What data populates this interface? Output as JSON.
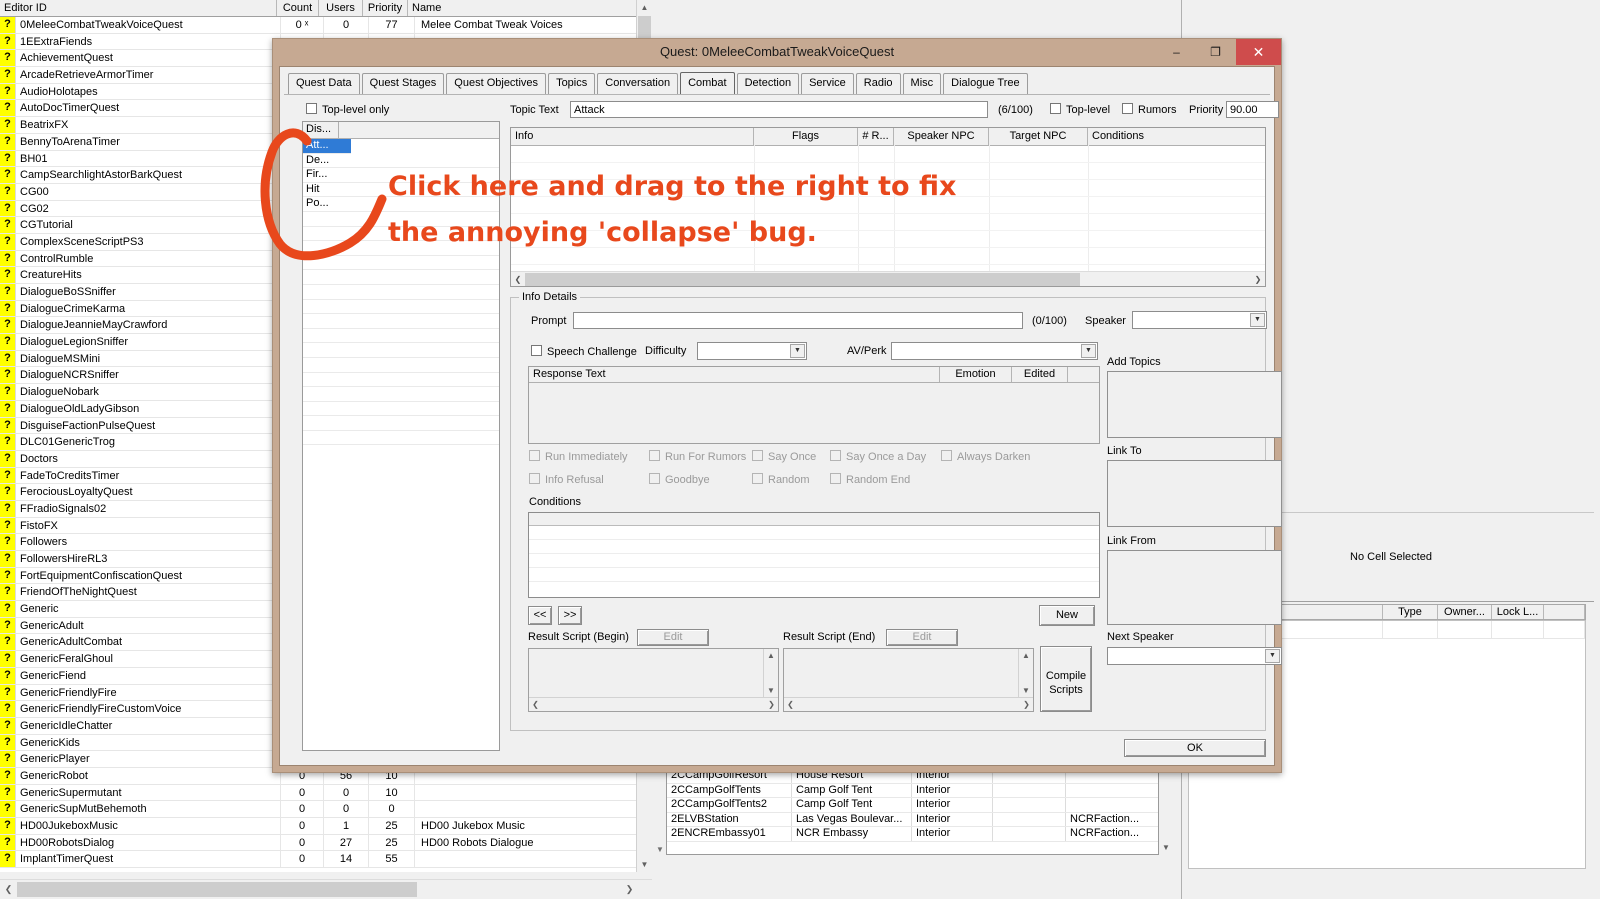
{
  "object_window": {
    "columns": [
      "Editor ID",
      "Count",
      "Users",
      "Priority",
      "Name"
    ],
    "rows": [
      {
        "id": "0MeleeCombatTweakVoiceQuest",
        "count": "0 ˣ",
        "users": "0",
        "priority": "77",
        "name": "Melee Combat Tweak Voices"
      },
      {
        "id": "1EExtraFiends",
        "count": "",
        "users": "",
        "priority": "",
        "name": ""
      },
      {
        "id": "AchievementQuest",
        "count": "",
        "users": "",
        "priority": "",
        "name": ""
      },
      {
        "id": "ArcadeRetrieveArmorTimer",
        "count": "",
        "users": "",
        "priority": "",
        "name": ""
      },
      {
        "id": "AudioHolotapes",
        "count": "",
        "users": "",
        "priority": "",
        "name": ""
      },
      {
        "id": "AutoDocTimerQuest",
        "count": "",
        "users": "",
        "priority": "",
        "name": ""
      },
      {
        "id": "BeatrixFX",
        "count": "",
        "users": "",
        "priority": "",
        "name": ""
      },
      {
        "id": "BennyToArenaTimer",
        "count": "",
        "users": "",
        "priority": "",
        "name": ""
      },
      {
        "id": "BH01",
        "count": "",
        "users": "",
        "priority": "",
        "name": ""
      },
      {
        "id": "CampSearchlightAstorBarkQuest",
        "count": "",
        "users": "",
        "priority": "",
        "name": ""
      },
      {
        "id": "CG00",
        "count": "",
        "users": "",
        "priority": "",
        "name": ""
      },
      {
        "id": "CG02",
        "count": "",
        "users": "",
        "priority": "",
        "name": ""
      },
      {
        "id": "CGTutorial",
        "count": "",
        "users": "",
        "priority": "",
        "name": ""
      },
      {
        "id": "ComplexSceneScriptPS3",
        "count": "",
        "users": "",
        "priority": "",
        "name": ""
      },
      {
        "id": "ControlRumble",
        "count": "",
        "users": "",
        "priority": "",
        "name": ""
      },
      {
        "id": "CreatureHits",
        "count": "",
        "users": "",
        "priority": "",
        "name": ""
      },
      {
        "id": "DialogueBoSSniffer",
        "count": "",
        "users": "",
        "priority": "",
        "name": ""
      },
      {
        "id": "DialogueCrimeKarma",
        "count": "",
        "users": "",
        "priority": "",
        "name": ""
      },
      {
        "id": "DialogueJeannieMayCrawford",
        "count": "",
        "users": "",
        "priority": "",
        "name": ""
      },
      {
        "id": "DialogueLegionSniffer",
        "count": "",
        "users": "",
        "priority": "",
        "name": ""
      },
      {
        "id": "DialogueMSMini",
        "count": "",
        "users": "",
        "priority": "",
        "name": ""
      },
      {
        "id": "DialogueNCRSniffer",
        "count": "",
        "users": "",
        "priority": "",
        "name": ""
      },
      {
        "id": "DialogueNobark",
        "count": "",
        "users": "",
        "priority": "",
        "name": ""
      },
      {
        "id": "DialogueOldLadyGibson",
        "count": "",
        "users": "",
        "priority": "",
        "name": ""
      },
      {
        "id": "DisguiseFactionPulseQuest",
        "count": "",
        "users": "",
        "priority": "",
        "name": ""
      },
      {
        "id": "DLC01GenericTrog",
        "count": "",
        "users": "",
        "priority": "",
        "name": ""
      },
      {
        "id": "Doctors",
        "count": "",
        "users": "",
        "priority": "",
        "name": ""
      },
      {
        "id": "FadeToCreditsTimer",
        "count": "",
        "users": "",
        "priority": "",
        "name": ""
      },
      {
        "id": "FerociousLoyaltyQuest",
        "count": "",
        "users": "",
        "priority": "",
        "name": ""
      },
      {
        "id": "FFradioSignals02",
        "count": "",
        "users": "",
        "priority": "",
        "name": ""
      },
      {
        "id": "FistoFX",
        "count": "",
        "users": "",
        "priority": "",
        "name": ""
      },
      {
        "id": "Followers",
        "count": "",
        "users": "",
        "priority": "",
        "name": ""
      },
      {
        "id": "FollowersHireRL3",
        "count": "",
        "users": "",
        "priority": "",
        "name": ""
      },
      {
        "id": "FortEquipmentConfiscationQuest",
        "count": "",
        "users": "",
        "priority": "",
        "name": ""
      },
      {
        "id": "FriendOfTheNightQuest",
        "count": "",
        "users": "",
        "priority": "",
        "name": ""
      },
      {
        "id": "Generic",
        "count": "",
        "users": "",
        "priority": "",
        "name": ""
      },
      {
        "id": "GenericAdult",
        "count": "",
        "users": "",
        "priority": "",
        "name": ""
      },
      {
        "id": "GenericAdultCombat",
        "count": "",
        "users": "",
        "priority": "",
        "name": ""
      },
      {
        "id": "GenericFeralGhoul",
        "count": "",
        "users": "",
        "priority": "",
        "name": ""
      },
      {
        "id": "GenericFiend",
        "count": "",
        "users": "",
        "priority": "",
        "name": ""
      },
      {
        "id": "GenericFriendlyFire",
        "count": "",
        "users": "",
        "priority": "",
        "name": ""
      },
      {
        "id": "GenericFriendlyFireCustomVoice",
        "count": "",
        "users": "",
        "priority": "",
        "name": ""
      },
      {
        "id": "GenericIdleChatter",
        "count": "",
        "users": "",
        "priority": "",
        "name": ""
      },
      {
        "id": "GenericKids",
        "count": "",
        "users": "",
        "priority": "",
        "name": ""
      },
      {
        "id": "GenericPlayer",
        "count": "",
        "users": "",
        "priority": "",
        "name": ""
      },
      {
        "id": "GenericRobot",
        "count": "0",
        "users": "56",
        "priority": "10",
        "name": ""
      },
      {
        "id": "GenericSupermutant",
        "count": "0",
        "users": "0",
        "priority": "10",
        "name": ""
      },
      {
        "id": "GenericSupMutBehemoth",
        "count": "0",
        "users": "0",
        "priority": "0",
        "name": ""
      },
      {
        "id": "HD00JukeboxMusic",
        "count": "0",
        "users": "1",
        "priority": "25",
        "name": "HD00 Jukebox Music"
      },
      {
        "id": "HD00RobotsDialog",
        "count": "0",
        "users": "27",
        "priority": "25",
        "name": "HD00 Robots Dialogue"
      },
      {
        "id": "ImplantTimerQuest",
        "count": "0",
        "users": "14",
        "priority": "55",
        "name": ""
      }
    ],
    "row_icon": "?"
  },
  "cell_view": {
    "no_cell_selected": "No Cell Selected",
    "columns": [
      "",
      "Type",
      "Owner...",
      "Lock L...",
      ""
    ]
  },
  "object_sublist": {
    "rows": [
      {
        "id": "2CCampGolfResort",
        "name": "House Resort",
        "type": "Interior",
        "blank": "",
        "faction": ""
      },
      {
        "id": "2CCampGolfTents",
        "name": "Camp Golf Tent",
        "type": "Interior",
        "blank": "",
        "faction": ""
      },
      {
        "id": "2CCampGolfTents2",
        "name": "Camp Golf Tent",
        "type": "Interior",
        "blank": "",
        "faction": ""
      },
      {
        "id": "2ELVBStation",
        "name": "Las Vegas Boulevar...",
        "type": "Interior",
        "blank": "",
        "faction": "NCRFaction..."
      },
      {
        "id": "2ENCREmbassy01",
        "name": "NCR Embassy",
        "type": "Interior",
        "blank": "",
        "faction": "NCRFaction..."
      }
    ]
  },
  "dialog": {
    "title": "Quest: 0MeleeCombatTweakVoiceQuest",
    "window_buttons": {
      "minimize": "–",
      "maximize": "❐",
      "close": "✕"
    },
    "tabs": [
      {
        "label": "Quest Data",
        "selected": false
      },
      {
        "label": "Quest Stages",
        "selected": false
      },
      {
        "label": "Quest Objectives",
        "selected": false
      },
      {
        "label": "Topics",
        "selected": false
      },
      {
        "label": "Conversation",
        "selected": false
      },
      {
        "label": "Combat",
        "selected": true
      },
      {
        "label": "Detection",
        "selected": false
      },
      {
        "label": "Service",
        "selected": false
      },
      {
        "label": "Radio",
        "selected": false
      },
      {
        "label": "Misc",
        "selected": false
      },
      {
        "label": "Dialogue Tree",
        "selected": false
      }
    ],
    "top_level_only_label": "Top-level only",
    "topic_list": {
      "header": "Dis...",
      "items": [
        {
          "label": "Att...",
          "selected": true
        },
        {
          "label": "De...",
          "selected": false
        },
        {
          "label": "Fir...",
          "selected": false
        },
        {
          "label": "Hit",
          "selected": false
        },
        {
          "label": "Po...",
          "selected": false
        }
      ]
    },
    "topic_text": {
      "label": "Topic Text",
      "value": "Attack",
      "counter": "(6/100)",
      "top_level_label": "Top-level",
      "rumors_label": "Rumors",
      "priority_label": "Priority",
      "priority_value": "90.00"
    },
    "info_list": {
      "columns": [
        "Info",
        "Flags",
        "# R...",
        "Speaker NPC",
        "Target NPC",
        "Conditions"
      ],
      "rows": []
    },
    "info_details": {
      "group_label": "Info Details",
      "prompt_label": "Prompt",
      "prompt_value": "",
      "prompt_counter": "(0/100)",
      "speaker_label": "Speaker",
      "speaker_value": "",
      "speech_challenge_label": "Speech Challenge",
      "difficulty_label": "Difficulty",
      "difficulty_value": "",
      "av_perk_label": "AV/Perk",
      "av_perk_value": "",
      "response_columns": [
        "Response Text",
        "Emotion",
        "Edited",
        ""
      ],
      "flags": [
        "Run Immediately",
        "Run For Rumors",
        "Say Once",
        "Say Once a Day",
        "Always Darken",
        "Info Refusal",
        "Goodbye",
        "Random",
        "Random End"
      ],
      "conditions_label": "Conditions",
      "prev_button": "<<",
      "next_button": ">>",
      "new_button": "New",
      "result_script_begin_label": "Result Script (Begin)",
      "result_script_end_label": "Result Script (End)",
      "edit_button": "Edit",
      "compile_scripts_button": "Compile Scripts",
      "add_topics_label": "Add Topics",
      "link_to_label": "Link To",
      "link_from_label": "Link From",
      "next_speaker_label": "Next Speaker",
      "next_speaker_value": ""
    },
    "ok_button": "OK"
  },
  "annotation": {
    "line1": "Click here and drag to the right to fix",
    "line2": "the annoying 'collapse' bug.",
    "color": "#e8481c"
  }
}
